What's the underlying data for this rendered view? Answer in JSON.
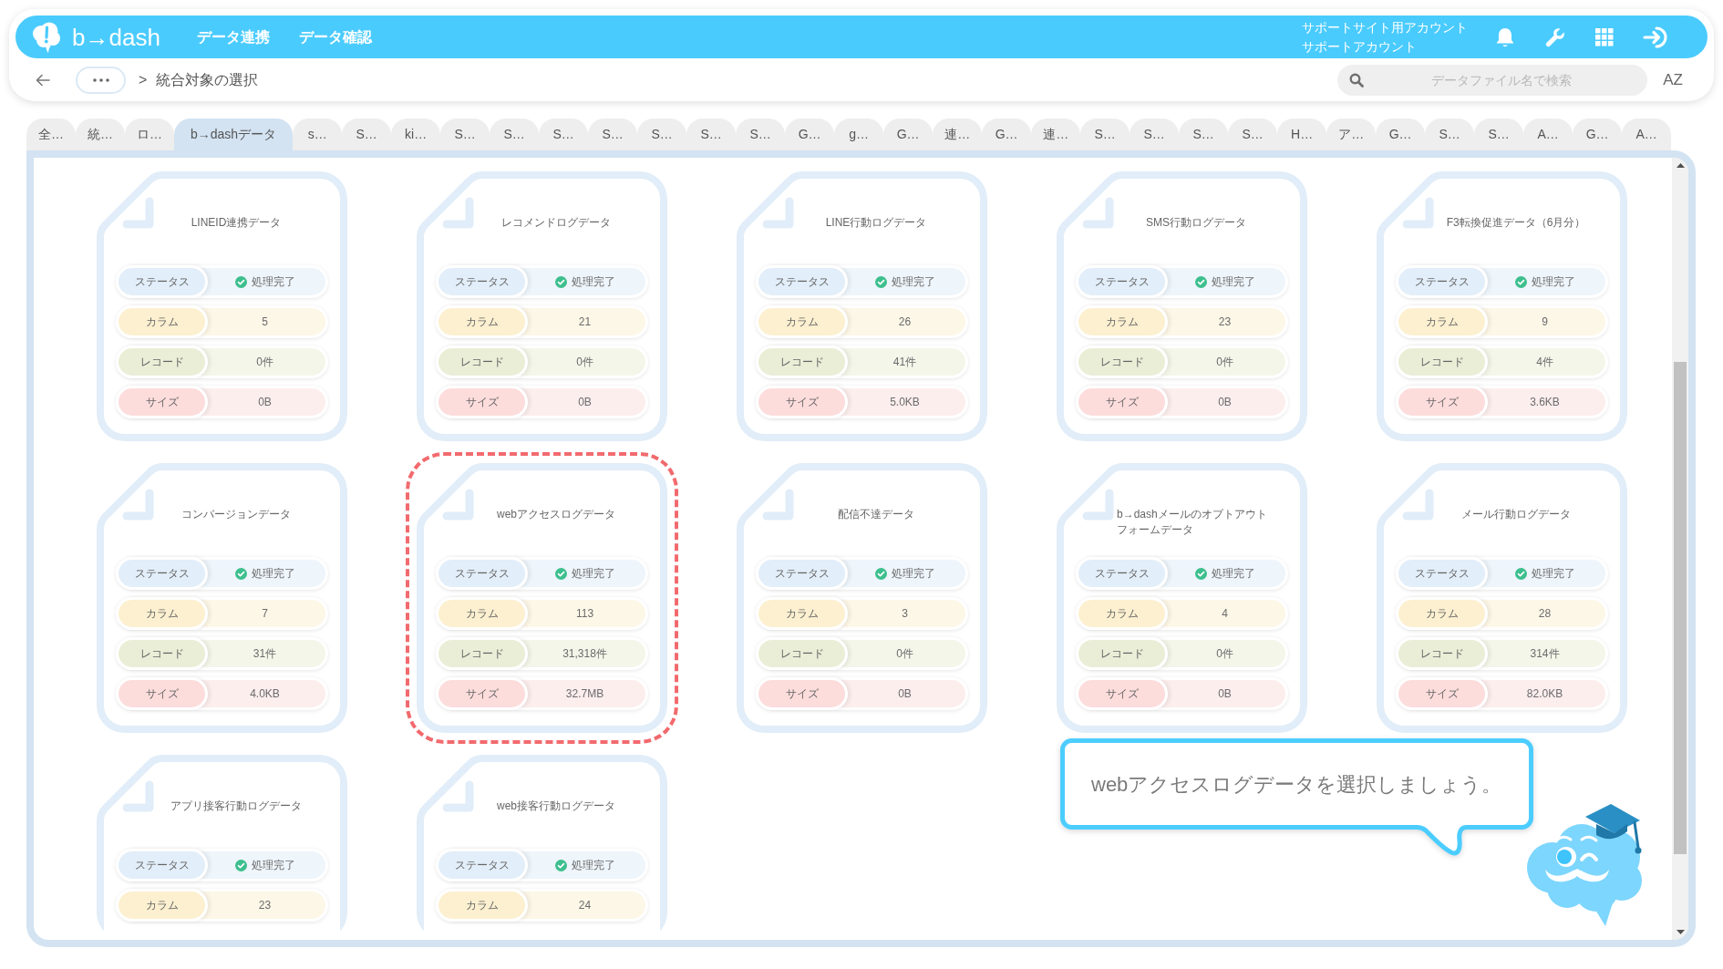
{
  "header": {
    "logo": "b→dash",
    "nav": [
      "データ連携",
      "データ確認"
    ],
    "account": {
      "site": "サポートサイト用アカウント",
      "name": "サポートアカウント"
    }
  },
  "toolbar": {
    "breadcrumb": {
      "separator": ">",
      "current": "統合対象の選択"
    },
    "search": {
      "placeholder": "データファイル名で検索"
    },
    "sort_label": "AZ"
  },
  "tabs": [
    {
      "label": "全…",
      "selected": false
    },
    {
      "label": "統…",
      "selected": false
    },
    {
      "label": "ロ…",
      "selected": false
    },
    {
      "label": "b→dashデータ",
      "selected": true
    },
    {
      "label": "s…",
      "selected": false
    },
    {
      "label": "S…",
      "selected": false
    },
    {
      "label": "ki…",
      "selected": false
    },
    {
      "label": "S…",
      "selected": false
    },
    {
      "label": "S…",
      "selected": false
    },
    {
      "label": "S…",
      "selected": false
    },
    {
      "label": "S…",
      "selected": false
    },
    {
      "label": "S…",
      "selected": false
    },
    {
      "label": "S…",
      "selected": false
    },
    {
      "label": "S…",
      "selected": false
    },
    {
      "label": "G…",
      "selected": false
    },
    {
      "label": "g…",
      "selected": false
    },
    {
      "label": "G…",
      "selected": false
    },
    {
      "label": "連…",
      "selected": false
    },
    {
      "label": "G…",
      "selected": false
    },
    {
      "label": "連…",
      "selected": false
    },
    {
      "label": "S…",
      "selected": false
    },
    {
      "label": "S…",
      "selected": false
    },
    {
      "label": "S…",
      "selected": false
    },
    {
      "label": "S…",
      "selected": false
    },
    {
      "label": "H…",
      "selected": false
    },
    {
      "label": "ア…",
      "selected": false
    },
    {
      "label": "G…",
      "selected": false
    },
    {
      "label": "S…",
      "selected": false
    },
    {
      "label": "S…",
      "selected": false
    },
    {
      "label": "A…",
      "selected": false
    },
    {
      "label": "G…",
      "selected": false
    },
    {
      "label": "A…",
      "selected": false
    }
  ],
  "cards": [
    {
      "title": "LINEID連携データ",
      "selected": false,
      "rows": [
        {
          "kind": "status",
          "label": "ステータス",
          "value": "処理完了"
        },
        {
          "kind": "column",
          "label": "カラム",
          "value": "5"
        },
        {
          "kind": "record",
          "label": "レコード",
          "value": "0件"
        },
        {
          "kind": "size",
          "label": "サイズ",
          "value": "0B"
        }
      ]
    },
    {
      "title": "レコメンドログデータ",
      "selected": false,
      "rows": [
        {
          "kind": "status",
          "label": "ステータス",
          "value": "処理完了"
        },
        {
          "kind": "column",
          "label": "カラム",
          "value": "21"
        },
        {
          "kind": "record",
          "label": "レコード",
          "value": "0件"
        },
        {
          "kind": "size",
          "label": "サイズ",
          "value": "0B"
        }
      ]
    },
    {
      "title": "LINE行動ログデータ",
      "selected": false,
      "rows": [
        {
          "kind": "status",
          "label": "ステータス",
          "value": "処理完了"
        },
        {
          "kind": "column",
          "label": "カラム",
          "value": "26"
        },
        {
          "kind": "record",
          "label": "レコード",
          "value": "41件"
        },
        {
          "kind": "size",
          "label": "サイズ",
          "value": "5.0KB"
        }
      ]
    },
    {
      "title": "SMS行動ログデータ",
      "selected": false,
      "rows": [
        {
          "kind": "status",
          "label": "ステータス",
          "value": "処理完了"
        },
        {
          "kind": "column",
          "label": "カラム",
          "value": "23"
        },
        {
          "kind": "record",
          "label": "レコード",
          "value": "0件"
        },
        {
          "kind": "size",
          "label": "サイズ",
          "value": "0B"
        }
      ]
    },
    {
      "title": "F3転換促進データ（6月分）",
      "selected": false,
      "rows": [
        {
          "kind": "status",
          "label": "ステータス",
          "value": "処理完了"
        },
        {
          "kind": "column",
          "label": "カラム",
          "value": "9"
        },
        {
          "kind": "record",
          "label": "レコード",
          "value": "4件"
        },
        {
          "kind": "size",
          "label": "サイズ",
          "value": "3.6KB"
        }
      ]
    },
    {
      "title": "コンバージョンデータ",
      "selected": false,
      "rows": [
        {
          "kind": "status",
          "label": "ステータス",
          "value": "処理完了"
        },
        {
          "kind": "column",
          "label": "カラム",
          "value": "7"
        },
        {
          "kind": "record",
          "label": "レコード",
          "value": "31件"
        },
        {
          "kind": "size",
          "label": "サイズ",
          "value": "4.0KB"
        }
      ]
    },
    {
      "title": "webアクセスログデータ",
      "selected": true,
      "rows": [
        {
          "kind": "status",
          "label": "ステータス",
          "value": "処理完了"
        },
        {
          "kind": "column",
          "label": "カラム",
          "value": "113"
        },
        {
          "kind": "record",
          "label": "レコード",
          "value": "31,318件"
        },
        {
          "kind": "size",
          "label": "サイズ",
          "value": "32.7MB"
        }
      ]
    },
    {
      "title": "配信不達データ",
      "selected": false,
      "rows": [
        {
          "kind": "status",
          "label": "ステータス",
          "value": "処理完了"
        },
        {
          "kind": "column",
          "label": "カラム",
          "value": "3"
        },
        {
          "kind": "record",
          "label": "レコード",
          "value": "0件"
        },
        {
          "kind": "size",
          "label": "サイズ",
          "value": "0B"
        }
      ]
    },
    {
      "title": "b→dashメールのオプトアウトフォームデータ",
      "selected": false,
      "rows": [
        {
          "kind": "status",
          "label": "ステータス",
          "value": "処理完了"
        },
        {
          "kind": "column",
          "label": "カラム",
          "value": "4"
        },
        {
          "kind": "record",
          "label": "レコード",
          "value": "0件"
        },
        {
          "kind": "size",
          "label": "サイズ",
          "value": "0B"
        }
      ]
    },
    {
      "title": "メール行動ログデータ",
      "selected": false,
      "rows": [
        {
          "kind": "status",
          "label": "ステータス",
          "value": "処理完了"
        },
        {
          "kind": "column",
          "label": "カラム",
          "value": "28"
        },
        {
          "kind": "record",
          "label": "レコード",
          "value": "314件"
        },
        {
          "kind": "size",
          "label": "サイズ",
          "value": "82.0KB"
        }
      ]
    },
    {
      "title": "アプリ接客行動ログデータ",
      "selected": false,
      "rows": [
        {
          "kind": "status",
          "label": "ステータス",
          "value": "処理完了"
        },
        {
          "kind": "column",
          "label": "カラム",
          "value": "23"
        }
      ]
    },
    {
      "title": "web接客行動ログデータ",
      "selected": false,
      "rows": [
        {
          "kind": "status",
          "label": "ステータス",
          "value": "処理完了"
        },
        {
          "kind": "column",
          "label": "カラム",
          "value": "24"
        }
      ]
    }
  ],
  "guide": {
    "message": "webアクセスログデータを選択しましょう。"
  }
}
